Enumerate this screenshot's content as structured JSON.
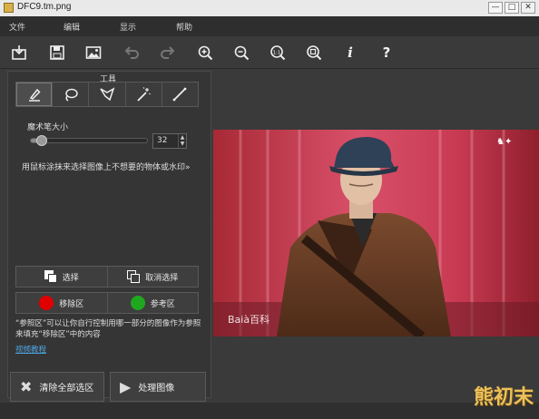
{
  "window": {
    "title": "DFC9.tm.png",
    "controls": [
      "—",
      "□",
      "✕"
    ]
  },
  "menu": [
    "文件",
    "编辑",
    "显示",
    "帮助"
  ],
  "toolbar": {
    "buttons": [
      {
        "name": "open-icon",
        "glyph": "⇩",
        "enabled": true
      },
      {
        "name": "save-icon",
        "glyph": "💾",
        "enabled": true
      },
      {
        "name": "image-icon",
        "glyph": "▣",
        "enabled": true
      },
      {
        "name": "undo-icon",
        "glyph": "↶",
        "enabled": false
      },
      {
        "name": "redo-icon",
        "glyph": "↷",
        "enabled": false
      },
      {
        "name": "zoom-in-icon",
        "glyph": "+",
        "enabled": true
      },
      {
        "name": "zoom-out-icon",
        "glyph": "−",
        "enabled": true
      },
      {
        "name": "actual-size-icon",
        "glyph": "1:1",
        "enabled": true
      },
      {
        "name": "fit-icon",
        "glyph": "⌖",
        "enabled": true
      },
      {
        "name": "info-icon",
        "glyph": "i",
        "enabled": true
      },
      {
        "name": "help-icon",
        "glyph": "?",
        "enabled": true
      }
    ]
  },
  "tools": {
    "group_label": "工具",
    "items": [
      {
        "name": "brush-tool-icon",
        "active": true
      },
      {
        "name": "lasso-tool-icon",
        "active": false
      },
      {
        "name": "polygon-lasso-tool-icon",
        "active": false
      },
      {
        "name": "magic-wand-tool-icon",
        "active": false
      },
      {
        "name": "line-tool-icon",
        "active": false
      }
    ]
  },
  "brush": {
    "label": "魔术笔大小",
    "value": "32",
    "level_percent": 6
  },
  "hint": "用鼠标涂抹来选择图像上不想要的物体或水印»",
  "selection": {
    "select_label": "选择",
    "deselect_label": "取消选择"
  },
  "regions": {
    "remove_label": "移除区",
    "remove_color": "#e00000",
    "reference_label": "参考区",
    "reference_color": "#1fa81f"
  },
  "note": "“参照区”可以让你自行控制用哪一部分的图像作为参照来填充“移除区”中的内容",
  "tutorial_link": "视频教程",
  "actions": {
    "clear_label": "清除全部选区",
    "process_label": "处理图像"
  },
  "overlay": {
    "photo_watermark": "Baià百科",
    "corner_logo": "熊初末"
  }
}
